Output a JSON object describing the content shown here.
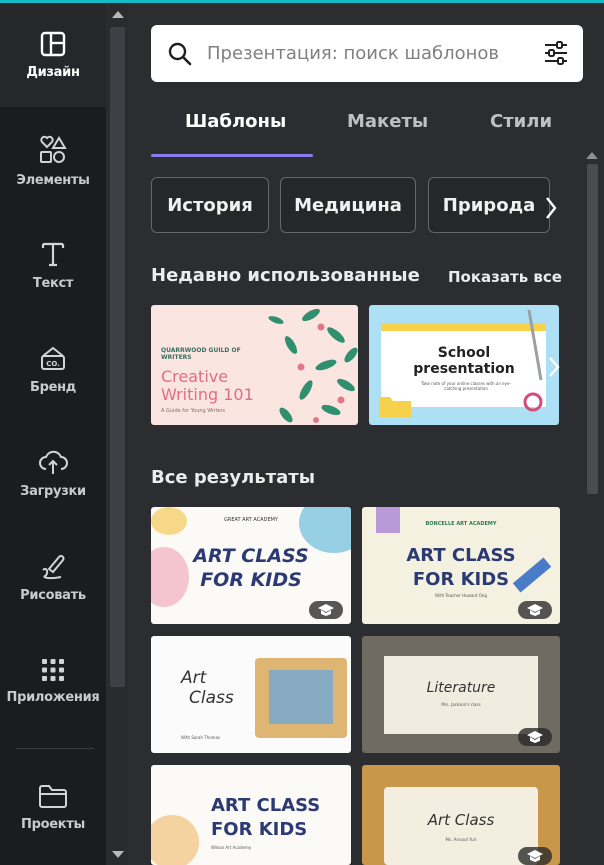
{
  "rail": {
    "items": [
      {
        "label": "Дизайн",
        "icon": "layout-icon"
      },
      {
        "label": "Элементы",
        "icon": "elements-icon"
      },
      {
        "label": "Текст",
        "icon": "text-icon"
      },
      {
        "label": "Бренд",
        "icon": "brand-icon"
      },
      {
        "label": "Загрузки",
        "icon": "upload-icon"
      },
      {
        "label": "Рисовать",
        "icon": "draw-icon"
      },
      {
        "label": "Приложения",
        "icon": "apps-icon"
      },
      {
        "label": "Проекты",
        "icon": "folder-icon"
      }
    ]
  },
  "search": {
    "placeholder": "Презентация: поиск шаблонов"
  },
  "tabs": [
    {
      "label": "Шаблоны"
    },
    {
      "label": "Макеты"
    },
    {
      "label": "Стили"
    }
  ],
  "chips": [
    {
      "label": "История"
    },
    {
      "label": "Медицина"
    },
    {
      "label": "Природа"
    }
  ],
  "recent": {
    "title": "Недавно использованные",
    "see_all": "Показать все",
    "cards": [
      {
        "brand": "QUARRWOOD GUILD OF WRITERS",
        "title_line1": "Creative",
        "title_line2": "Writing 101",
        "subtitle": "A Guide for Young Writers"
      },
      {
        "title_line1": "School",
        "title_line2": "presentation",
        "subtitle": "Take note of your online classes with an eye-catching presentation"
      }
    ]
  },
  "results": {
    "title": "Все результаты",
    "cards": [
      {
        "top": "GREAT ART ACADEMY",
        "line1": "ART CLASS",
        "line2": "FOR KIDS"
      },
      {
        "top": "BONCELLE ART ACADEMY",
        "line1": "ART CLASS",
        "line2": "FOR KIDS",
        "sub": "With Teacher Howard Ong"
      },
      {
        "line1": "Art",
        "line2": "Class",
        "sub": "With Sarah Thomas"
      },
      {
        "line1": "Literature",
        "sub": "Mrs. Jackson's class"
      },
      {
        "line1": "ART CLASS",
        "line2": "FOR KIDS",
        "sub": "Wilson Art Academy"
      },
      {
        "line1": "Art Class",
        "sub": "Ms. Arnaud Yuri"
      }
    ]
  },
  "colors": {
    "accent": "#8b7cf0",
    "top_line": "#18b9c7",
    "rail_bg": "#1b1c20",
    "panel_bg": "#2b2d31"
  }
}
